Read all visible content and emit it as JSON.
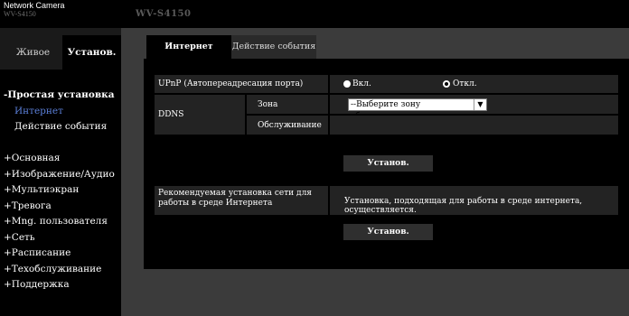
{
  "header": {
    "product": "Network Camera",
    "model_small": "WV-S4150",
    "model_big": "WV-S4150"
  },
  "sidebar": {
    "tabs": [
      {
        "label": "Живое"
      },
      {
        "label": "Установ."
      }
    ],
    "simple_setup": {
      "title": "-Простая установка",
      "items": [
        {
          "label": "Интернет",
          "active": true
        },
        {
          "label": "Действие события",
          "active": false
        }
      ]
    },
    "menu": [
      {
        "label": "+Основная"
      },
      {
        "label": "+Изображение/Аудио"
      },
      {
        "label": "+Мультиэкран"
      },
      {
        "label": "+Тревога"
      },
      {
        "label": "+Mng. пользователя"
      },
      {
        "label": "+Сеть"
      },
      {
        "label": "+Расписание"
      },
      {
        "label": "+Техобслуживание"
      },
      {
        "label": "+Поддержка"
      }
    ]
  },
  "content": {
    "tabs": [
      {
        "label": "Интернет"
      },
      {
        "label": "Действие события"
      }
    ],
    "upnp": {
      "label": "UPnP (Автопереадресация порта)",
      "on_label": "Вкл.",
      "off_label": "Откл.",
      "selected": "Откл."
    },
    "ddns": {
      "label": "DDNS",
      "zone_label": "Зона",
      "zone_value": "--Выберите зону обслуживания--",
      "service_label": "Обслуживание",
      "service_value": ""
    },
    "set_button": "Установ.",
    "recommended": {
      "label": "Рекомендуемая установка сети для работы в среде Интернета",
      "value": "Установка, подходящая для работы в среде интернета, осуществляется."
    },
    "set_button_2": "Установ."
  },
  "colors": {
    "background": "#000000",
    "content_bg": "#3b3b3b",
    "row_bg": "#232323",
    "active_link": "#5b7fd8"
  }
}
